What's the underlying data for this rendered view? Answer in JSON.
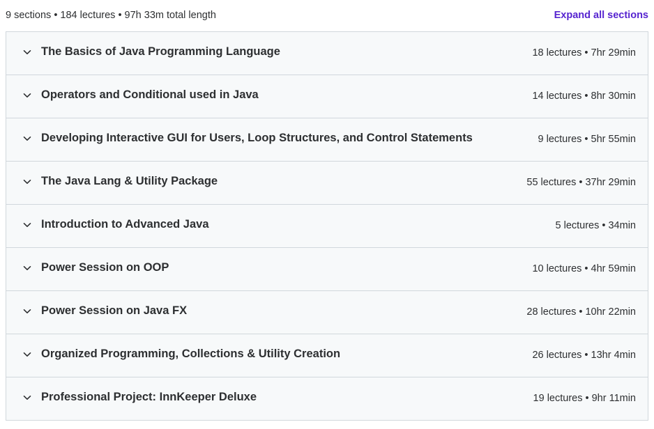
{
  "curriculum": {
    "summary": "9 sections • 184 lectures • 97h 33m total length",
    "expand_all_label": "Expand all sections",
    "sections": [
      {
        "title": "The Basics of Java Programming Language",
        "meta": "18 lectures • 7hr 29min"
      },
      {
        "title": "Operators and Conditional used in Java",
        "meta": "14 lectures • 8hr 30min"
      },
      {
        "title": "Developing Interactive GUI for Users, Loop Structures, and Control Statements",
        "meta": "9 lectures • 5hr 55min"
      },
      {
        "title": "The Java Lang & Utility Package",
        "meta": "55 lectures • 37hr 29min"
      },
      {
        "title": "Introduction to Advanced Java",
        "meta": "5 lectures • 34min"
      },
      {
        "title": "Power Session on OOP",
        "meta": "10 lectures • 4hr 59min"
      },
      {
        "title": "Power Session on Java FX",
        "meta": "28 lectures • 10hr 22min"
      },
      {
        "title": "Organized Programming, Collections & Utility Creation",
        "meta": "26 lectures • 13hr 4min"
      },
      {
        "title": "Professional Project: InnKeeper Deluxe",
        "meta": "19 lectures • 9hr 11min"
      }
    ]
  },
  "colors": {
    "accent": "#5624d0",
    "text": "#2d2f31",
    "section_bg": "#f7f9fa",
    "border": "#d1d7dc"
  },
  "icons": {
    "section_toggle": "chevron-down-icon"
  }
}
